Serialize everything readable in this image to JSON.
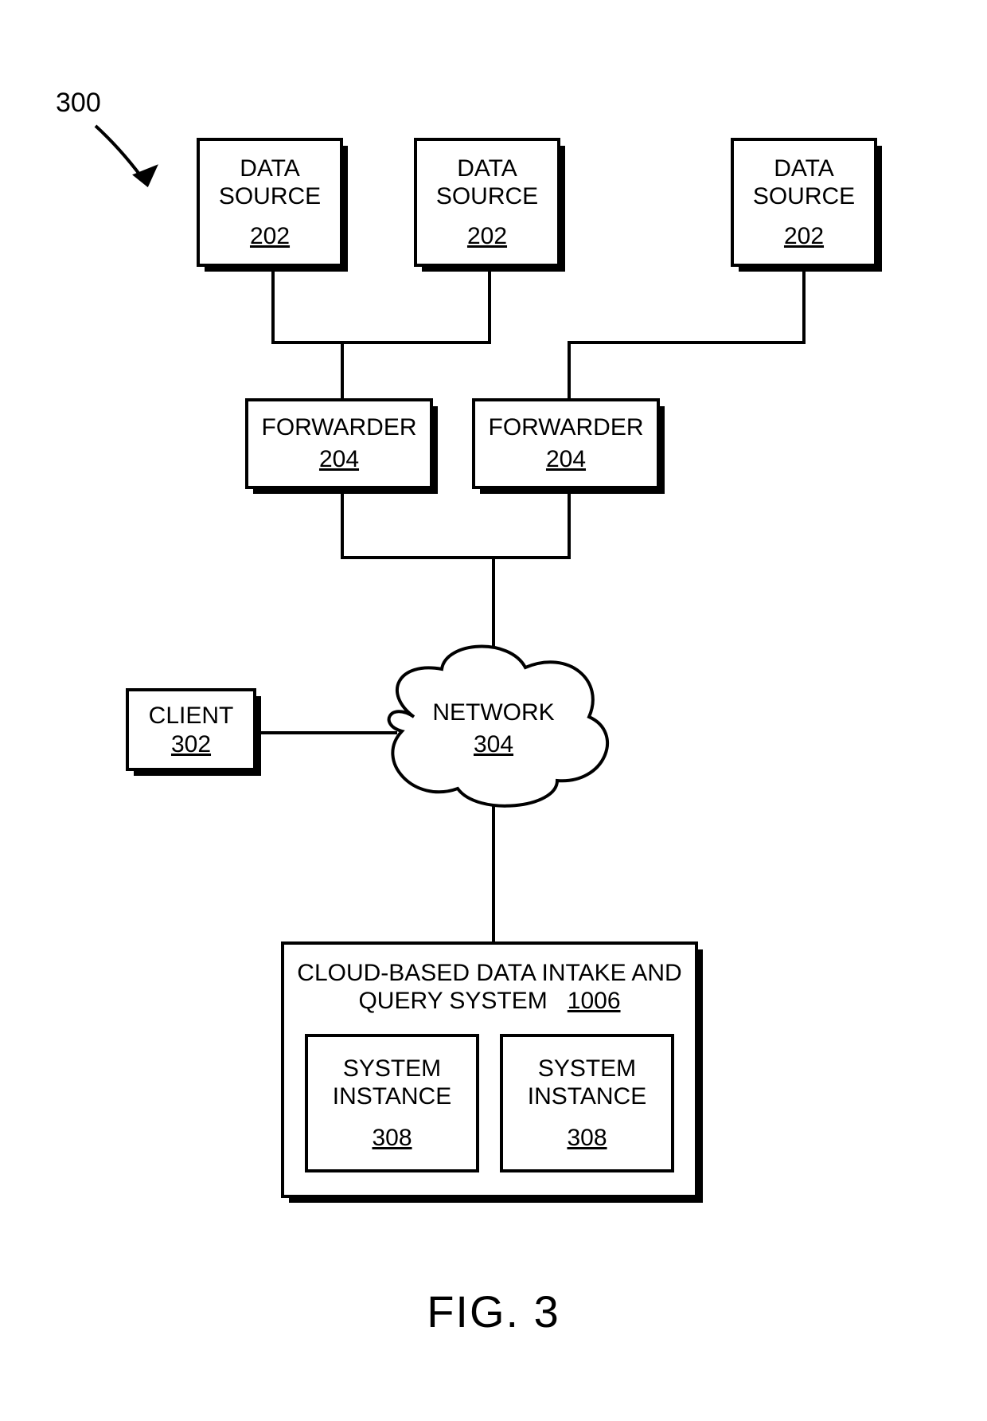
{
  "figure_ref": "300",
  "data_source_1": {
    "title": "DATA\nSOURCE",
    "ref": "202"
  },
  "data_source_2": {
    "title": "DATA\nSOURCE",
    "ref": "202"
  },
  "data_source_3": {
    "title": "DATA\nSOURCE",
    "ref": "202"
  },
  "forwarder_1": {
    "title": "FORWARDER",
    "ref": "204"
  },
  "forwarder_2": {
    "title": "FORWARDER",
    "ref": "204"
  },
  "client": {
    "title": "CLIENT",
    "ref": "302"
  },
  "network": {
    "title": "NETWORK",
    "ref": "304"
  },
  "cloud_system": {
    "title": "CLOUD-BASED DATA INTAKE\nAND QUERY SYSTEM",
    "ref": "1006"
  },
  "instance_1": {
    "title": "SYSTEM\nINSTANCE",
    "ref": "308"
  },
  "instance_2": {
    "title": "SYSTEM\nINSTANCE",
    "ref": "308"
  },
  "caption": "FIG. 3"
}
